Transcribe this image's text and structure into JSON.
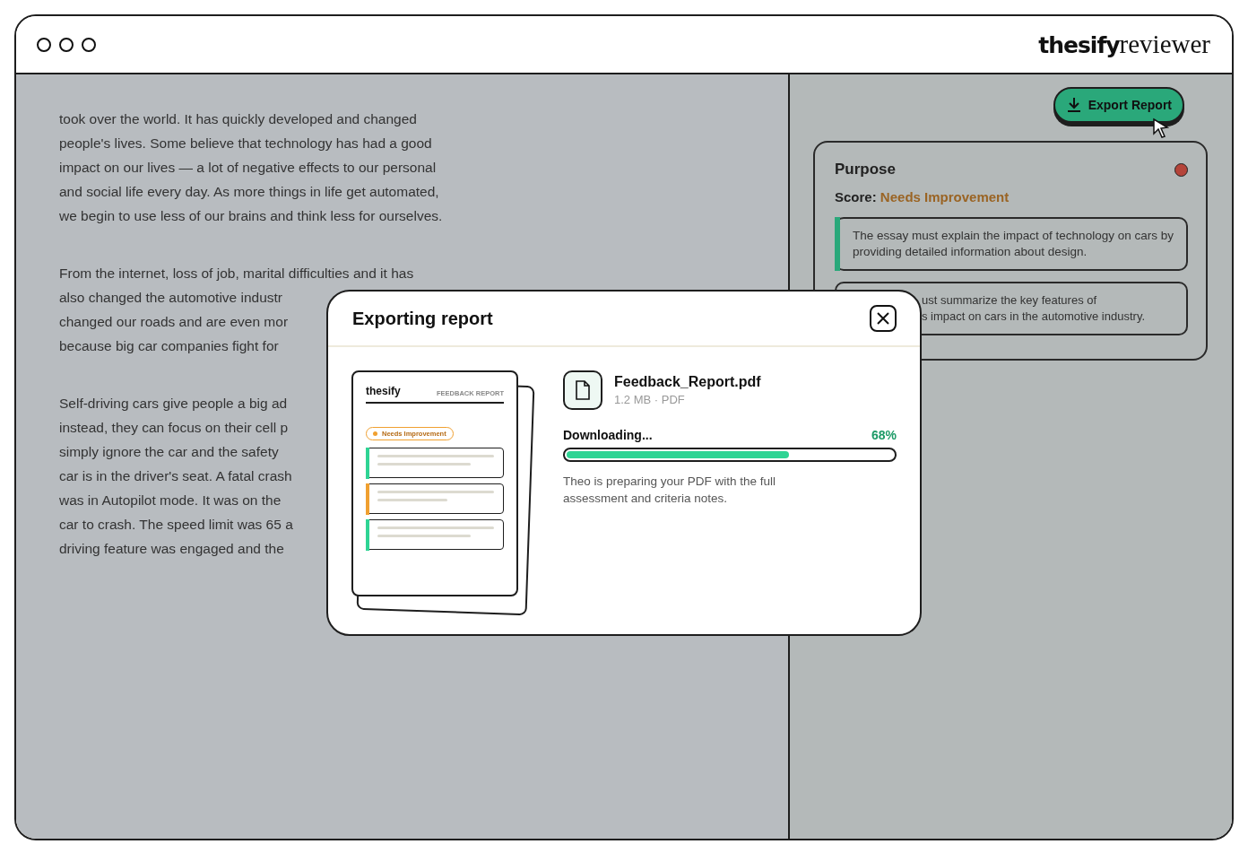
{
  "window": {
    "logo": {
      "brand": "thesify",
      "product": "reviewer"
    }
  },
  "essay": {
    "paragraphs": [
      [
        "took over the world. It has quickly developed and changed",
        "people's lives. Some believe that technology has had a good",
        "impact on our lives — a lot of negative effects to our personal",
        "and social life every day. As more things in life get automated,",
        "we begin to use less of our brains and think less for ourselves."
      ],
      [
        "From the internet, loss of job, marital difficulties and it has",
        "also changed the automotive industr",
        "changed our roads and are even mor",
        "because big car companies fight for"
      ],
      [
        "Self-driving cars give people a big ad",
        "instead, they can focus on their cell p",
        "simply ignore the car and the safety",
        "car is in the driver's seat. A fatal crash",
        "was in Autopilot mode. It was on the",
        "car to crash. The speed limit was 65 a",
        "driving feature was engaged and the"
      ]
    ]
  },
  "sidebar": {
    "export_button": "Export Report",
    "criterion": {
      "title": "Purpose",
      "color": "#b5443a",
      "score_label": "Score:",
      "score_value": "Needs Improvement",
      "notes": [
        {
          "lines": [
            "The essay must explain the impact of technology on cars by providing detailed information about design."
          ],
          "color": "#2aa87a",
          "covered": false
        },
        {
          "lines": [
            "ust summarize the key features of",
            "s impact on cars in the automotive industry."
          ],
          "covered": true
        }
      ]
    }
  },
  "modal": {
    "title": "Exporting report",
    "preview": {
      "brand": "thesify",
      "heading": "FEEDBACK REPORT",
      "badge": "Needs Improvement",
      "cards": [
        {
          "color": "#2fd494"
        },
        {
          "color": "#f0a030"
        },
        {
          "color": "#2fd494"
        }
      ]
    },
    "file": {
      "name": "Feedback_Report.pdf",
      "meta": "1.2 MB · PDF"
    },
    "progress": {
      "label": "Downloading...",
      "percent": "68%",
      "level": 0.68
    },
    "message": "Theo is preparing your PDF with the full assessment and criteria notes."
  }
}
